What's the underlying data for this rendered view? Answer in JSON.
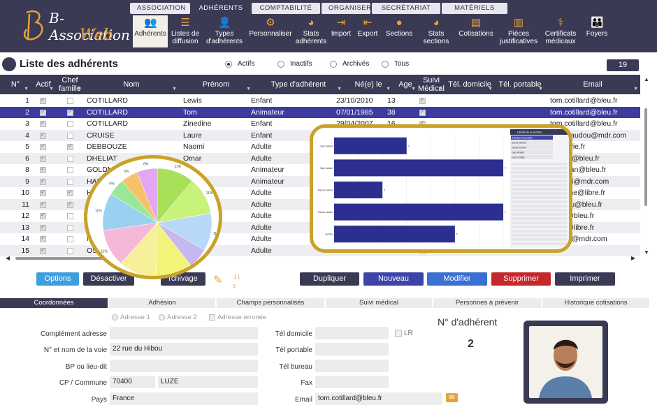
{
  "app": {
    "logo_line1": "B-Association",
    "logo_line2": "Web"
  },
  "top_tabs": [
    {
      "label": "ASSOCIATION",
      "active": false
    },
    {
      "label": "ADHÉRENTS",
      "active": true
    },
    {
      "label": "COMPTABILITÉ",
      "active": false
    },
    {
      "label": "ORGANISER",
      "active": false
    },
    {
      "label": "SECRÉTARIAT",
      "active": false
    },
    {
      "label": "MATÉRIELS",
      "active": false
    }
  ],
  "toolbar": [
    {
      "label": "Adhérents",
      "icon": "users-icon",
      "active": true
    },
    {
      "label": "Listes de diffusion",
      "icon": "list-icon",
      "active": false
    },
    {
      "label": "Types d'adhérents",
      "icon": "user-type-icon",
      "active": false
    },
    {
      "label": "Personnaliser",
      "icon": "sliders-icon",
      "active": false
    },
    {
      "label": "Stats adhérents",
      "icon": "pie-chart-icon",
      "active": false
    },
    {
      "label": "Import",
      "icon": "import-icon",
      "active": false
    },
    {
      "label": "Export",
      "icon": "export-icon",
      "active": false
    },
    {
      "label": "Sections",
      "icon": "sections-icon",
      "active": false
    },
    {
      "label": "Stats sections",
      "icon": "pie-chart-icon",
      "active": false
    },
    {
      "label": "Cotisations",
      "icon": "wallet-icon",
      "active": false
    },
    {
      "label": "Pièces justificatives",
      "icon": "document-icon",
      "active": false
    },
    {
      "label": "Certificats médicaux",
      "icon": "stethoscope-icon",
      "active": false
    },
    {
      "label": "Foyers",
      "icon": "family-icon",
      "active": false
    }
  ],
  "page_title": "Liste des adhérents",
  "filters": [
    {
      "label": "Actifs",
      "selected": true
    },
    {
      "label": "Inactifs",
      "selected": false
    },
    {
      "label": "Archivés",
      "selected": false
    },
    {
      "label": "Tous",
      "selected": false
    }
  ],
  "record_count": "19",
  "columns": [
    "N°",
    "Actif",
    "Chef famille",
    "Nom",
    "Prénom",
    "Type d'adhérent",
    "Né(e) le",
    "Age",
    "Suivi Médical",
    "Tél. domicile",
    "Tél. portable",
    "Email"
  ],
  "rows": [
    {
      "n": "1",
      "actif": true,
      "chef": false,
      "nom": "COTILLARD",
      "prenom": "Lewis",
      "type": "Enfant",
      "ne": "23/10/2010",
      "age": "13",
      "suivi": true,
      "email": "tom.cotillard@bleu.fr"
    },
    {
      "n": "2",
      "actif": true,
      "chef": true,
      "nom": "COTILLARD",
      "prenom": "Tom",
      "type": "Animateur",
      "ne": "07/01/1985",
      "age": "38",
      "suivi": true,
      "email": "tom.cotillard@bleu.fr"
    },
    {
      "n": "3",
      "actif": true,
      "chef": false,
      "nom": "COTILLARD",
      "prenom": "Zinedine",
      "type": "Enfant",
      "ne": "29/04/2007",
      "age": "16",
      "suivi": true,
      "email": "tom.cotillard@bleu.fr"
    },
    {
      "n": "4",
      "actif": true,
      "chef": false,
      "nom": "CRUISE",
      "prenom": "Laure",
      "type": "Enfant",
      "ne": "",
      "age": "",
      "suivi": false,
      "email": "oma.naudou@mdr.com"
    },
    {
      "n": "5",
      "actif": true,
      "chef": true,
      "nom": "DEBBOUZE",
      "prenom": "Naomi",
      "type": "Adulte",
      "ne": "",
      "age": "",
      "suivi": false,
      "email": "omi@vie.fr"
    },
    {
      "n": "6",
      "actif": true,
      "chef": false,
      "nom": "DHELIAT",
      "prenom": "Omar",
      "type": "Adulte",
      "ne": "",
      "age": "",
      "suivi": false,
      "email": "dheliat@bleu.fr"
    },
    {
      "n": "8",
      "actif": true,
      "chef": false,
      "nom": "GOLDM",
      "prenom": "hie",
      "type": "Animateur",
      "ne": "",
      "age": "",
      "suivi": false,
      "email": "goldman@bleu.fr"
    },
    {
      "n": "9",
      "actif": true,
      "chef": false,
      "nom": "HAB",
      "prenom": "",
      "type": "Animateur",
      "ne": "",
      "age": "",
      "suivi": false,
      "email": "shabibi@mdr.com"
    },
    {
      "n": "10",
      "actif": true,
      "chef": true,
      "nom": "H",
      "prenom": "",
      "type": "Adulte",
      "ne": "",
      "age": "",
      "suivi": false,
      "email": "onceline@libre.fr"
    },
    {
      "n": "11",
      "actif": true,
      "chef": true,
      "nom": "H",
      "prenom": "",
      "type": "Adulte",
      "ne": "",
      "age": "",
      "suivi": false,
      "email": "naudou@bleu.fr"
    },
    {
      "n": "12",
      "actif": true,
      "chef": false,
      "nom": "",
      "prenom": "",
      "type": "Adulte",
      "ne": "",
      "age": "",
      "suivi": false,
      "email": "1975@bleu.fr"
    },
    {
      "n": "13",
      "actif": true,
      "chef": false,
      "nom": "",
      "prenom": "",
      "type": "Adulte",
      "ne": "",
      "age": "",
      "suivi": false,
      "email": "pe70@libre.fr"
    },
    {
      "n": "14",
      "actif": true,
      "chef": false,
      "nom": "N",
      "prenom": "",
      "type": "Adulte",
      "ne": "",
      "age": "",
      "suivi": false,
      "email": "y.noah@mdr.com"
    },
    {
      "n": "15",
      "actif": true,
      "chef": false,
      "nom": "OS",
      "prenom": "",
      "type": "Adulte",
      "ne": "",
      "age": "",
      "suivi": false,
      "email": ""
    }
  ],
  "selected_row": 1,
  "buttons": {
    "options": "Options",
    "desactiver": "Désactiver",
    "archivage": "rchivage",
    "dupliquer": "Dupliquer",
    "nouveau": "Nouveau",
    "modifier": "Modifier",
    "supprimer": "Supprimer",
    "imprimer": "Imprimer"
  },
  "detail_tabs": [
    {
      "label": "Coordonnées",
      "active": true
    },
    {
      "label": "Adhésion",
      "active": false
    },
    {
      "label": "Champs personnalisés",
      "active": false
    },
    {
      "label": "Suivi médical",
      "active": false
    },
    {
      "label": "Personnes à prévenir",
      "active": false
    },
    {
      "label": "Historique cotisations",
      "active": false
    }
  ],
  "address_options": [
    "Adresse 1",
    "Adresse 2",
    "Adresse erronée"
  ],
  "form": {
    "complement_label": "Complément adresse",
    "complement": "",
    "voie_label": "N° et nom de la voie",
    "voie": "22 rue du Hibou",
    "bp_label": "BP ou lieu-dit",
    "bp": "",
    "cp_label": "CP / Commune",
    "cp": "70400",
    "commune": "LUZE",
    "pays_label": "Pays",
    "pays": "France",
    "tel_dom_label": "Tél domicile",
    "tel_dom": "",
    "lr": "LR",
    "tel_port_label": "Tél portable",
    "tel_port": "",
    "tel_bur_label": "Tél bureau",
    "tel_bur": "",
    "fax_label": "Fax",
    "fax": "",
    "email_label": "Email",
    "email": "tom.cotillard@bleu.fr",
    "num_label": "N° d'adhérent",
    "num": "2"
  },
  "pie_overlay": {
    "labels": [
      "11%",
      "11%",
      "11%",
      "6%",
      "11%",
      "11%",
      "11%",
      "11%",
      "5%",
      "5%",
      "6%"
    ],
    "values": [
      11,
      11,
      11,
      6,
      11,
      11,
      11,
      11,
      5,
      5,
      6
    ],
    "colors": [
      "#a8e05a",
      "#c9f27a",
      "#b8d8f7",
      "#c8b8f0",
      "#f0f57a",
      "#f7f09a",
      "#f5b8d8",
      "#9ad0f0",
      "#98e898",
      "#f5c26b",
      "#e3a6f2"
    ]
  },
  "bar_overlay": {
    "type": "bar",
    "categories": [
      "Gym Enfant",
      "Gym Adulte",
      "Danse Enfant",
      "Danse Adulte",
      "Zumba"
    ],
    "values": [
      3,
      7,
      2,
      7,
      5
    ],
    "xlim": [
      0,
      7
    ],
    "legend_title": "Libellé de la section",
    "legend_items": [
      "Activités manuelles",
      "Danse Adulte",
      "Danse Enfant",
      "Gym Adulte",
      "Gym Enfant"
    ]
  }
}
